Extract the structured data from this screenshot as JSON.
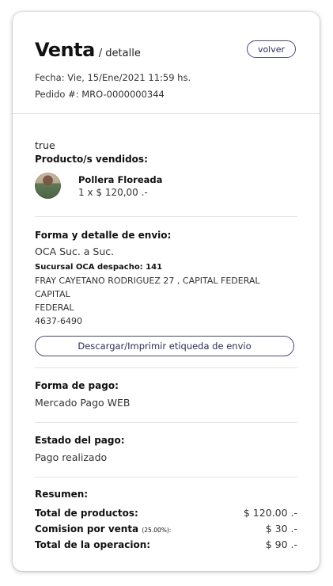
{
  "header": {
    "title": "Venta",
    "subtitle": "/ detalle",
    "back_label": "volver",
    "date": "Fecha: Vie, 15/Ene/2021 11:59 hs.",
    "order": "Pedido #: MRO-0000000344"
  },
  "misc_text": "true",
  "products": {
    "title": "Producto/s vendidos:",
    "items": [
      {
        "name": "Pollera Floreada",
        "qty_price": "1 x $ 120,00 .-"
      }
    ]
  },
  "shipping": {
    "title": "Forma y detalle de envio:",
    "method": "OCA Suc. a Suc.",
    "branch": "Sucursal OCA despacho: 141",
    "address_line1": "FRAY CAYETANO RODRIGUEZ 27 , CAPITAL FEDERAL CAPITAL",
    "address_line2": "FEDERAL",
    "phone": "4637-6490",
    "label_button": "Descargar/Imprimir etiqueda de envio"
  },
  "payment": {
    "title": "Forma de pago:",
    "method": "Mercado Pago WEB"
  },
  "payment_status": {
    "title": "Estado del pago:",
    "value": "Pago realizado"
  },
  "summary": {
    "title": "Resumen:",
    "total_products_label": "Total de productos:",
    "total_products_value": "$ 120.00 .-",
    "commission_label": "Comision por venta",
    "commission_pct": "(25.00%):",
    "commission_value": "$ 30 .-",
    "total_operation_label": "Total de la operacion:",
    "total_operation_value": "$ 90 .-"
  },
  "colors": {
    "accent": "#4a4a7a",
    "divider": "#e4e4e4"
  }
}
